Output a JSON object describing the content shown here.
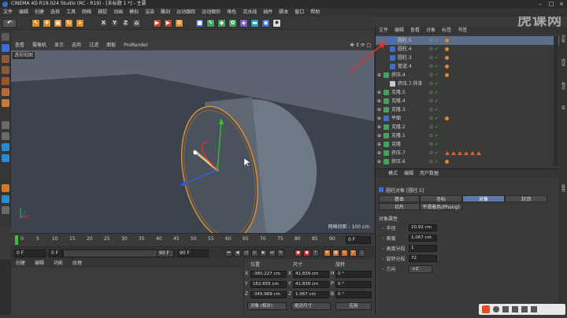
{
  "titlebar": {
    "title": "CINEMA 4D R19.024 Studio (RC - R19) - [未标题 1 *] - 主要",
    "min": "–",
    "max": "□",
    "close": "×"
  },
  "menubar": {
    "items": [
      "文件",
      "编辑",
      "创建",
      "选择",
      "工具",
      "网格",
      "捕捉",
      "动画",
      "模拟",
      "渲染",
      "雕刻",
      "运动跟踪",
      "运动图形",
      "角色",
      "流水线",
      "插件",
      "脚本",
      "窗口",
      "帮助"
    ]
  },
  "toolbar": {
    "x": "X",
    "y": "Y",
    "z": "Z"
  },
  "viewport": {
    "menu": [
      "查看",
      "摄像机",
      "显示",
      "选项",
      "过滤",
      "面板",
      "ProRender"
    ],
    "label": "透视视图",
    "grid_info": "网格间距 : 100 cm"
  },
  "timeline": {
    "ticks": [
      "0",
      "5",
      "10",
      "15",
      "20",
      "25",
      "30",
      "35",
      "40",
      "45",
      "50",
      "55",
      "60",
      "65",
      "70",
      "75",
      "80",
      "85",
      "90"
    ],
    "end_frame": "0 F",
    "cur_frame": "0 F",
    "start_field": "0 F",
    "end_field": "90 F",
    "max_field": "90 F"
  },
  "material": {
    "menu": [
      "创建",
      "编辑",
      "功能",
      "纹理"
    ]
  },
  "coords": {
    "headers": {
      "pos": "位置",
      "size": "尺寸",
      "rot": "旋转"
    },
    "rows": [
      {
        "axis": "X",
        "pos": "-360.227 cm",
        "size_axis": "X",
        "size": "41.839 cm",
        "rot_axis": "H",
        "rot": "0 °"
      },
      {
        "axis": "Y",
        "pos": "162.655 cm",
        "size_axis": "Y",
        "size": "41.839 cm",
        "rot_axis": "P",
        "rot": "0 °"
      },
      {
        "axis": "Z",
        "pos": "-345.969 cm",
        "size_axis": "Z",
        "size": "1.067 cm",
        "rot_axis": "B",
        "rot": "0 °"
      }
    ],
    "mode_dropdown": "对象 (相对)",
    "size_dropdown": "绝对尺寸",
    "apply": "应用"
  },
  "objects": {
    "menu": [
      "文件",
      "编辑",
      "查看",
      "对象",
      "标签",
      "书签"
    ],
    "rows": [
      {
        "name": "圆柱.5",
        "selected": true,
        "indent": 1,
        "icon": "cylinder",
        "tags": [
          "orange"
        ]
      },
      {
        "name": "圆柱.4",
        "selected": false,
        "indent": 1,
        "icon": "cylinder",
        "tags": [
          "orange"
        ]
      },
      {
        "name": "圆柱.3",
        "selected": false,
        "indent": 1,
        "icon": "cylinder",
        "tags": [
          "orange"
        ]
      },
      {
        "name": "管道.4",
        "selected": false,
        "indent": 1,
        "icon": "cylinder",
        "tags": [
          "orange"
        ]
      },
      {
        "name": "挤压.4",
        "selected": false,
        "indent": 0,
        "icon": "extrude",
        "tags": [
          "orange"
        ]
      },
      {
        "name": "挤压.7.样条",
        "selected": false,
        "indent": 1,
        "icon": "spline",
        "tags": []
      },
      {
        "name": "克隆.5",
        "selected": false,
        "indent": 0,
        "icon": "cloner",
        "tags": []
      },
      {
        "name": "克隆.4",
        "selected": false,
        "indent": 0,
        "icon": "cloner",
        "tags": []
      },
      {
        "name": "克隆.3",
        "selected": false,
        "indent": 0,
        "icon": "cloner",
        "tags": []
      },
      {
        "name": "平面",
        "selected": false,
        "indent": 0,
        "icon": "plane",
        "tags": [
          "orange"
        ]
      },
      {
        "name": "克隆.2",
        "selected": false,
        "indent": 0,
        "icon": "cloner",
        "tags": []
      },
      {
        "name": "克隆.1",
        "selected": false,
        "indent": 0,
        "icon": "cloner",
        "tags": []
      },
      {
        "name": "克隆",
        "selected": false,
        "indent": 0,
        "icon": "cloner",
        "tags": []
      },
      {
        "name": "挤压.7",
        "selected": false,
        "indent": 0,
        "icon": "extrude",
        "tags": [
          "triangles"
        ]
      },
      {
        "name": "挤压.6",
        "selected": false,
        "indent": 0,
        "icon": "extrude",
        "tags": [
          "orange"
        ]
      }
    ]
  },
  "attributes": {
    "menu": [
      "模式",
      "编辑",
      "用户数据"
    ],
    "title": "圆柱对象 [圆柱.5]",
    "tabs_row1": [
      "基本",
      "坐标",
      "对象",
      "封顶"
    ],
    "tabs_row2": [
      "切片",
      "平滑着色(Phong)"
    ],
    "active_tab": "对象",
    "section": "对象属性",
    "props": [
      {
        "label": "半径",
        "value": "20.92 cm"
      },
      {
        "label": "高度",
        "value": "1.067 cm"
      },
      {
        "label": "高度分段",
        "value": "1"
      },
      {
        "label": "旋转分段",
        "value": "72"
      },
      {
        "label": "方向",
        "value": "+Z"
      }
    ]
  },
  "watermark": "虎课网",
  "colors": {
    "accent": "#e08a22",
    "selection": "#5b6d8a",
    "tab_active": "#5c79a8",
    "annotation": "#e03030"
  }
}
